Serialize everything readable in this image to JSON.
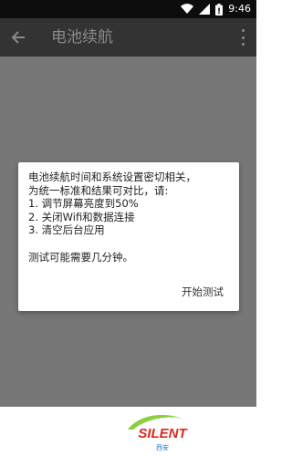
{
  "status_bar": {
    "time": "9:46",
    "icons": [
      "wifi-icon",
      "cell-signal-icon",
      "battery-icon"
    ],
    "battery_glyph": "!"
  },
  "toolbar": {
    "title": "电池续航",
    "back_icon": "arrow-left-icon",
    "more_icon": "more-vert-icon"
  },
  "dialog": {
    "lines": [
      "电池续航时间和系统设置密切相关，",
      "为统一标准和结果可对比，请:",
      "1. 调节屏幕亮度到50%",
      "2. 关闭Wifi和数据连接",
      "3. 清空后台应用"
    ],
    "footer": "测试可能需要几分钟。",
    "action_label": "开始测试"
  },
  "watermark": {
    "text": "SILENT",
    "subtext": "西安"
  },
  "colors": {
    "statusbar_bg": "#0d0d0d",
    "toolbar_bg": "#333333",
    "scrim": "#777777",
    "dialog_bg": "#ffffff",
    "logo_green": "#8ccf3e",
    "logo_red": "#e0281e",
    "logo_blue": "#1e6fc2"
  }
}
